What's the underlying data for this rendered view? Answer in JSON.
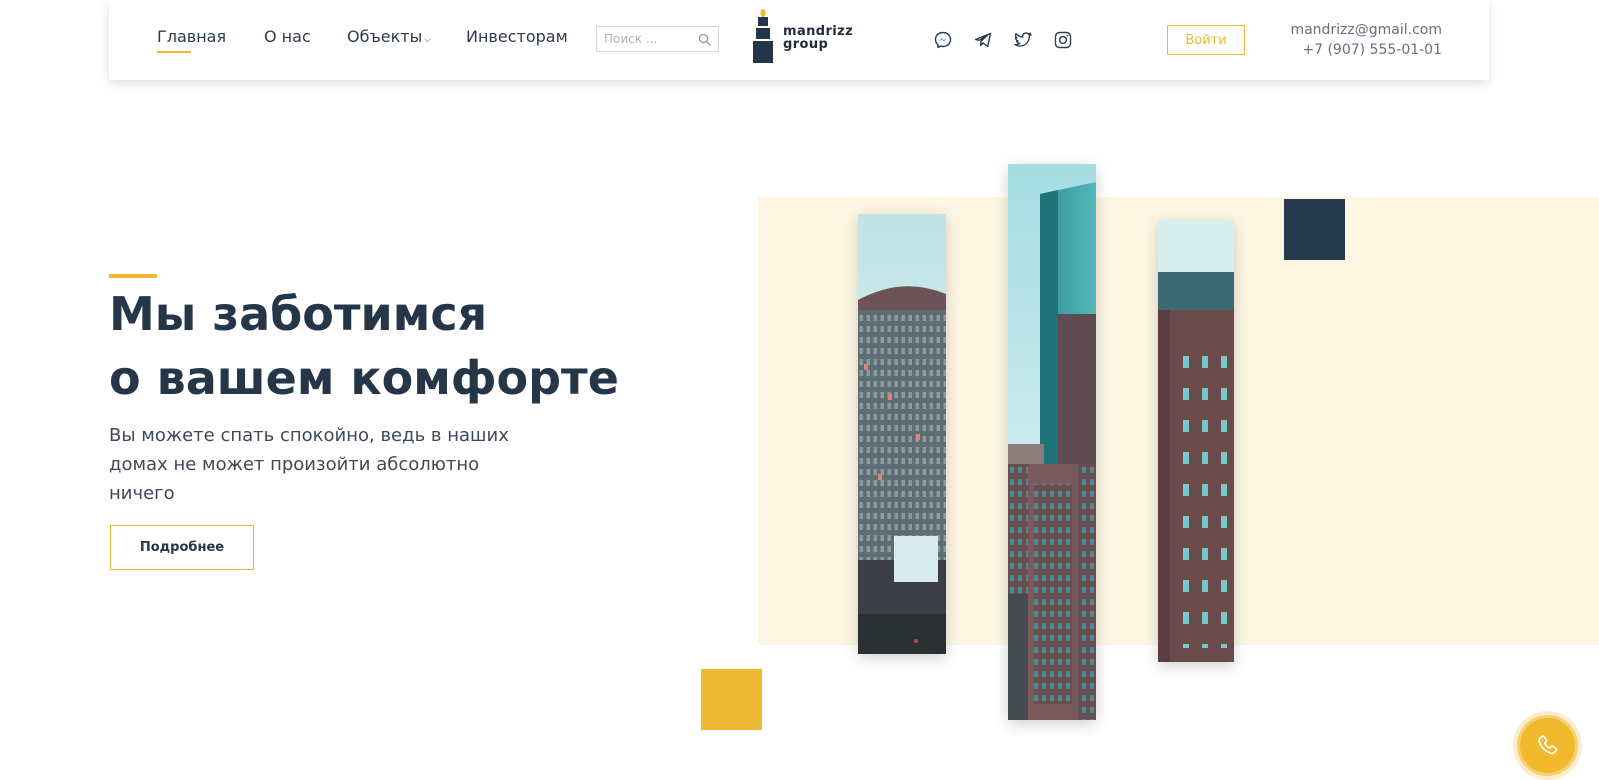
{
  "nav": {
    "items": [
      {
        "label": "Главная",
        "active": true
      },
      {
        "label": "О нас",
        "active": false
      },
      {
        "label": "Объекты",
        "active": false,
        "has_dropdown": true
      },
      {
        "label": "Инвесторам",
        "active": false
      }
    ],
    "dropdown_caret": "⌵"
  },
  "search": {
    "placeholder": "Поиск ...",
    "icon": "search-icon"
  },
  "logo": {
    "line1": "mandrizz",
    "line2": "group"
  },
  "social": [
    {
      "icon": "messenger-icon"
    },
    {
      "icon": "telegram-icon"
    },
    {
      "icon": "twitter-icon"
    },
    {
      "icon": "instagram-icon"
    }
  ],
  "login": {
    "label": "Войти"
  },
  "contact": {
    "email": "mandrizz@gmail.com",
    "phone": "+7 (907) 555-01-01"
  },
  "hero": {
    "title_line1": "Мы заботимся",
    "title_line2": "о вашем комфорте",
    "subtitle": "Вы можете спать спокойно, ведь в наших домах не может произойти абсолютно ничего",
    "button_label": "Подробнее"
  },
  "colors": {
    "accent": "#f0b92f",
    "navy": "#253648",
    "cream": "#fdf6e3"
  },
  "call_button": {
    "icon": "phone-icon"
  }
}
